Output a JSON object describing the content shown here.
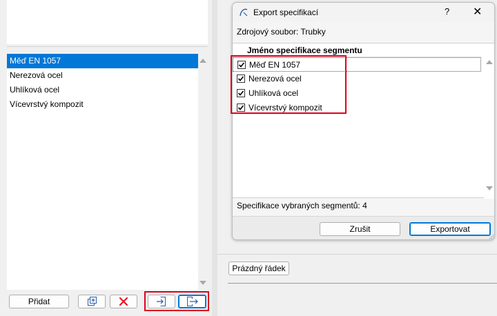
{
  "left_panel": {
    "list_items": [
      {
        "label": "Měď EN 1057",
        "selected": true
      },
      {
        "label": "Nerezová ocel",
        "selected": false
      },
      {
        "label": "Uhlíková ocel",
        "selected": false
      },
      {
        "label": "Vícevrstvý kompozit",
        "selected": false
      }
    ],
    "add_label": "Přidat"
  },
  "dialog": {
    "title": "Export specifikací",
    "help_glyph": "?",
    "close_glyph": "✕",
    "source_label": "Zdrojový soubor: Trubky",
    "column_header": "Jméno specifikace segmentu",
    "rows": [
      {
        "label": "Měď EN 1057",
        "checked": true
      },
      {
        "label": "Nerezová ocel",
        "checked": true
      },
      {
        "label": "Uhlíková ocel",
        "checked": true
      },
      {
        "label": "Vícevrstvý kompozit",
        "checked": true
      }
    ],
    "count_label": "Specifikace vybraných segmentů: 4",
    "cancel_label": "Zrušit",
    "export_label": "Exportovat"
  },
  "right_panel": {
    "empty_row_label": "Prázdný řádek"
  },
  "colors": {
    "selection": "#0078d7",
    "highlight_outline": "#e0001b",
    "delete_icon": "#e81123"
  }
}
